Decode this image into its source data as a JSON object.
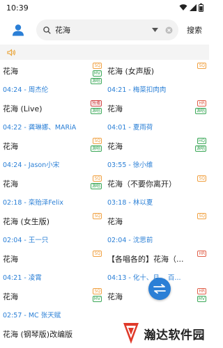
{
  "status_bar": {
    "time": "10:39"
  },
  "search": {
    "query": "花海",
    "placeholder": "",
    "button_label": "搜索"
  },
  "colors": {
    "accent": "#2b7fd6",
    "meta_text": "#2a7fd6",
    "sq_badge": "#f0a040",
    "mv_badge": "#3aa757",
    "hr_badge": "#e0604a"
  },
  "songs": [
    {
      "title": "花海",
      "meta": "04:24 - 周杰伦",
      "badges": [
        "SQ",
        "MV",
        "源唱"
      ]
    },
    {
      "title": "花海 (女声版)",
      "meta": "04:21 - 梅菜扣肉肉",
      "badges": [
        "SQ"
      ]
    },
    {
      "title": "花海 (Live)",
      "meta": "04:22 - 龚琳娜、MARiA",
      "badges": [
        "独播",
        "源唱"
      ]
    },
    {
      "title": "花海",
      "meta": "04:01 - 夏雨荷",
      "badges": [
        "HR",
        "源唱"
      ]
    },
    {
      "title": "花海",
      "meta": "04:24 - Jason小宋",
      "badges": [
        "SQ",
        "源唱"
      ]
    },
    {
      "title": "花海",
      "meta": "03:55 - 徐小维",
      "badges": [
        "HQ",
        "源唱"
      ]
    },
    {
      "title": "花海",
      "meta": "02:18 - 栾贻泽Felix",
      "badges": [
        "SQ",
        "源唱"
      ]
    },
    {
      "title": "花海（不要你离开）",
      "meta": "03:18 - 林以夏",
      "badges": [
        "SQ"
      ]
    },
    {
      "title": "花海 (女生版)",
      "meta": "02:04 - 王一只",
      "badges": [
        "SQ"
      ]
    },
    {
      "title": "花海",
      "meta": "02:04 - 沈思前",
      "badges": [
        "SQ"
      ]
    },
    {
      "title": "花海",
      "meta": "04:21 - 凌霄",
      "badges": [
        "SQ"
      ]
    },
    {
      "title": "【各唱各的】花海（...",
      "meta": "04:13 - 化十、月... 百...",
      "badges": [
        "HR"
      ]
    },
    {
      "title": "花海",
      "meta": "02:57 - MC 张天赋",
      "badges": [
        "SQ",
        "MV"
      ]
    },
    {
      "title": "花海",
      "meta": "",
      "badges": [
        "HR",
        "MV"
      ]
    },
    {
      "title": "花海 (钢琴版)改编版",
      "meta": "",
      "badges": []
    }
  ],
  "watermark": {
    "text": "瀚达软件园"
  }
}
